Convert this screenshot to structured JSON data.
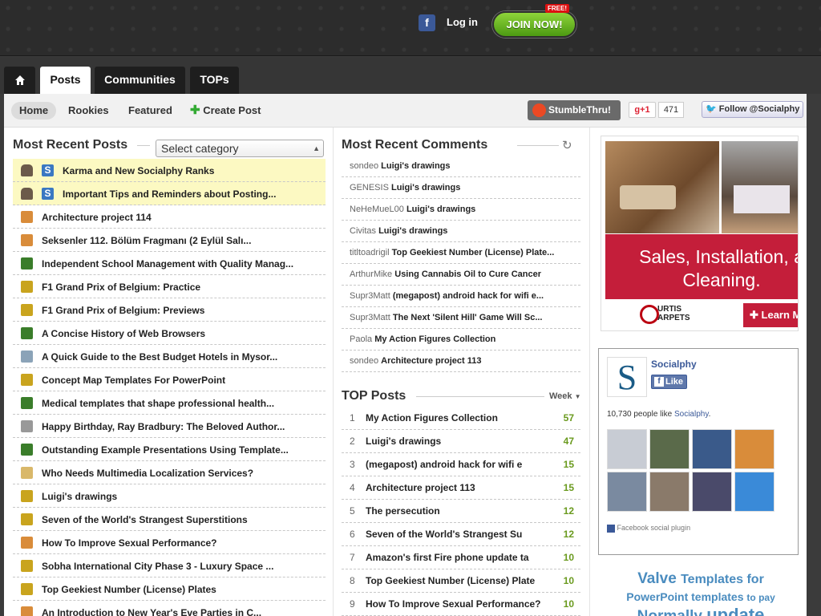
{
  "header": {
    "facebook_glyph": "f",
    "login_label": "Log in",
    "join_label": "JOIN NOW!",
    "free_badge": "FREE!"
  },
  "tabs": [
    {
      "label": "Posts",
      "active": true
    },
    {
      "label": "Communities"
    },
    {
      "label": "TOPs"
    }
  ],
  "subnav": {
    "home": "Home",
    "rookies": "Rookies",
    "featured": "Featured",
    "create_post": "Create Post",
    "stumble": "StumbleThru!",
    "gplus": "+1",
    "gplus_count": "471",
    "twitter": "Follow @Socialphy"
  },
  "recent_posts": {
    "title": "Most Recent Posts",
    "category_select": "Select category",
    "items": [
      {
        "title": "Karma and New Socialphy Ranks",
        "sticky": true
      },
      {
        "title": "Important Tips and Reminders about Posting...",
        "sticky": true
      },
      {
        "title": "Architecture project 114"
      },
      {
        "title": "Seksenler 112. Bölüm Fragmanı (2 Eylül Salı..."
      },
      {
        "title": "Independent School Management with Quality Manag..."
      },
      {
        "title": "F1 Grand Prix of Belgium: Practice"
      },
      {
        "title": "F1 Grand Prix of Belgium: Previews"
      },
      {
        "title": "A Concise History of Web Browsers"
      },
      {
        "title": "A Quick Guide to the Best Budget Hotels in Mysor..."
      },
      {
        "title": "Concept Map Templates For PowerPoint"
      },
      {
        "title": "Medical templates that shape professional health..."
      },
      {
        "title": "Happy Birthday, Ray Bradbury: The Beloved Author..."
      },
      {
        "title": "Outstanding Example Presentations Using Template..."
      },
      {
        "title": "Who Needs Multimedia Localization Services?"
      },
      {
        "title": "Luigi's drawings"
      },
      {
        "title": "Seven of the World's Strangest Superstitions"
      },
      {
        "title": "How To Improve Sexual Performance?"
      },
      {
        "title": "Sobha International City Phase 3 - Luxury Space ..."
      },
      {
        "title": "Top Geekiest Number (License) Plates"
      },
      {
        "title": "An Introduction to New Year's Eve Parties in C..."
      }
    ]
  },
  "recent_comments": {
    "title": "Most Recent Comments",
    "items": [
      {
        "user": "sondeo",
        "post": "Luigi's drawings"
      },
      {
        "user": "GENESIS",
        "post": "Luigi's drawings"
      },
      {
        "user": "NeHeMueL00",
        "post": "Luigi's drawings"
      },
      {
        "user": "Civitas",
        "post": "Luigi's drawings"
      },
      {
        "user": "titltoadrigil",
        "post": "Top Geekiest Number (License) Plate..."
      },
      {
        "user": "ArthurMike",
        "post": "Using Cannabis Oil to Cure Cancer"
      },
      {
        "user": "Supr3Matt",
        "post": "(megapost) android hack for wifi e..."
      },
      {
        "user": "Supr3Matt",
        "post": "The Next 'Silent Hill' Game Will Sc..."
      },
      {
        "user": "Paola",
        "post": "My Action Figures Collection"
      },
      {
        "user": "sondeo",
        "post": "Architecture project 113"
      }
    ]
  },
  "top_posts": {
    "title": "TOP Posts",
    "period": "Week",
    "items": [
      {
        "rank": "1",
        "title": "My Action Figures Collection",
        "score": "57"
      },
      {
        "rank": "2",
        "title": "Luigi's drawings",
        "score": "47"
      },
      {
        "rank": "3",
        "title": "(megapost) android hack for wifi e",
        "score": "15"
      },
      {
        "rank": "4",
        "title": "Architecture project 113",
        "score": "15"
      },
      {
        "rank": "5",
        "title": "The persecution",
        "score": "12"
      },
      {
        "rank": "6",
        "title": "Seven of the World's Strangest Su",
        "score": "12"
      },
      {
        "rank": "7",
        "title": "Amazon's first Fire phone update ta",
        "score": "10"
      },
      {
        "rank": "8",
        "title": "Top Geekiest Number (License) Plate",
        "score": "10"
      },
      {
        "rank": "9",
        "title": "How To Improve Sexual Performance?",
        "score": "10"
      }
    ]
  },
  "ad": {
    "tagline_1": "Sales, Installation, a",
    "tagline_2": "Cleaning.",
    "brand_1": "URTIS",
    "brand_2": "ARPETS",
    "cta": "Learn M"
  },
  "facebook_box": {
    "page_name": "Socialphy",
    "like_label": "Like",
    "fans_count": "10,730 people like",
    "fans_link": "Socialphy",
    "fans_end": ".",
    "plugin_label": "Facebook social plugin"
  },
  "valve_ad": {
    "line1_a": "Valve",
    "line1_b": "Templates for",
    "line2_a": "PowerPoint templates",
    "line2_b": "to pay",
    "line3": "Normally",
    "line3_b": "update"
  },
  "colors": {
    "accent_green": "#6a9a1e",
    "sticky_bg": "#fcf9c2",
    "facebook_blue": "#3b5998"
  }
}
